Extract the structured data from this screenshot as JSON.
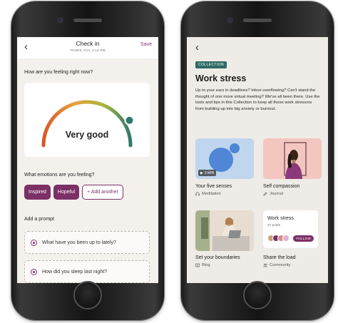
{
  "left_screen": {
    "header": {
      "title": "Check in",
      "date": "THURS 7/14, 2:14 PM",
      "save_label": "Save"
    },
    "feeling_question": "How are you feeling right now?",
    "mood": {
      "label": "Very good",
      "level": 0.82,
      "colors": [
        "#d9562a",
        "#e8a13a",
        "#a8b53f",
        "#2f7a6a"
      ]
    },
    "emotions_question": "What emotions are you feeling?",
    "emotion_chips": [
      {
        "label": "Inspired",
        "selected": true
      },
      {
        "label": "Hopeful",
        "selected": true
      },
      {
        "label": "+ Add another",
        "selected": false
      }
    ],
    "prompt_heading": "Add a prompt",
    "prompts": [
      "What have you been up to lately?",
      "How did you sleep last night?"
    ]
  },
  "right_screen": {
    "badge": "COLLECTION",
    "title": "Work stress",
    "description": "Up to your ears in deadlines? Inbox overflowing? Can't stand the thought of one more virtual meeting? We've all been there. Use the tools and tips in this Collection to keep all those work stressors from building up into big anxiety or burnout.",
    "cards": [
      {
        "title": "Your five senses",
        "type": "Meditation",
        "icon": "headphones-icon",
        "duration": "3 MIN"
      },
      {
        "title": "Self compassion",
        "type": "Journal",
        "icon": "pencil-icon"
      },
      {
        "title": "Set your boundaries",
        "type": "Blog",
        "icon": "book-icon"
      },
      {
        "title": "Share the load",
        "type": "Community",
        "icon": "people-icon"
      }
    ],
    "community_card": {
      "title": "Work stress",
      "posts": "27 posts",
      "follow_label": "FOLLOW"
    }
  },
  "colors": {
    "accent": "#7b3066",
    "teal": "#2d6b63",
    "screen_bg": "#f4f1ed"
  }
}
